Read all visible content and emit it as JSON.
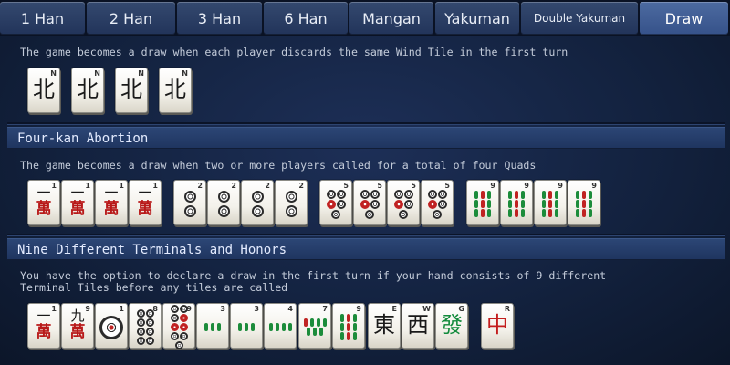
{
  "tabs": [
    "1 Han",
    "2 Han",
    "3 Han",
    "6 Han",
    "Mangan",
    "Yakuman",
    "Double Yakuman",
    "Draw"
  ],
  "active_tab": "Draw",
  "sections": [
    {
      "title": "",
      "desc": "The game becomes a draw when each player discards the same Wind Tile in the first turn",
      "tiles": [
        {
          "type": "honor",
          "char": "北",
          "badge": "N"
        },
        {
          "type": "honor",
          "char": "北",
          "badge": "N"
        },
        {
          "type": "honor",
          "char": "北",
          "badge": "N"
        },
        {
          "type": "honor",
          "char": "北",
          "badge": "N"
        }
      ]
    },
    {
      "title": "Four-kan Abortion",
      "desc": "The game becomes a draw when two or more players called for a total of four Quads",
      "tiles": [
        {
          "type": "man",
          "char": "一",
          "badge": "1"
        },
        {
          "type": "man",
          "char": "一",
          "badge": "1"
        },
        {
          "type": "man",
          "char": "一",
          "badge": "1"
        },
        {
          "type": "man",
          "char": "一",
          "badge": "1"
        },
        {
          "type": "pin",
          "n": 2,
          "badge": "2"
        },
        {
          "type": "pin",
          "n": 2,
          "badge": "2"
        },
        {
          "type": "pin",
          "n": 2,
          "badge": "2"
        },
        {
          "type": "pin",
          "n": 2,
          "badge": "2"
        },
        {
          "type": "pin",
          "n": 5,
          "badge": "5"
        },
        {
          "type": "pin",
          "n": 5,
          "badge": "5"
        },
        {
          "type": "pin",
          "n": 5,
          "badge": "5"
        },
        {
          "type": "pin",
          "n": 5,
          "badge": "5"
        },
        {
          "type": "sou",
          "n": 9,
          "badge": "9"
        },
        {
          "type": "sou",
          "n": 9,
          "badge": "9"
        },
        {
          "type": "sou",
          "n": 9,
          "badge": "9"
        },
        {
          "type": "sou",
          "n": 9,
          "badge": "9"
        }
      ]
    },
    {
      "title": "Nine Different Terminals and Honors",
      "desc": "You have the option to declare a draw in the first turn if your hand consists of 9 different\nTerminal Tiles  before any tiles are called",
      "tiles": [
        {
          "type": "man",
          "char": "一",
          "badge": "1"
        },
        {
          "type": "man",
          "char": "九",
          "badge": "9"
        },
        {
          "type": "pin",
          "n": 1,
          "badge": "1"
        },
        {
          "type": "pin",
          "n": 8,
          "badge": "8"
        },
        {
          "type": "pin",
          "n": 9,
          "badge": "9"
        },
        {
          "type": "sou",
          "n": 3,
          "badge": "3"
        },
        {
          "type": "sou",
          "n": 3,
          "badge": "3"
        },
        {
          "type": "sou",
          "n": 4,
          "badge": "4"
        },
        {
          "type": "sou",
          "n": 7,
          "badge": "7"
        },
        {
          "type": "sou",
          "n": 9,
          "badge": "9"
        },
        {
          "type": "honor",
          "char": "東",
          "badge": "E"
        },
        {
          "type": "honor",
          "char": "西",
          "badge": "W"
        },
        {
          "type": "honor",
          "char": "發",
          "badge": "G",
          "color": "green"
        },
        {
          "type": "honor",
          "char": "中",
          "badge": "R",
          "color": "red"
        }
      ]
    }
  ]
}
